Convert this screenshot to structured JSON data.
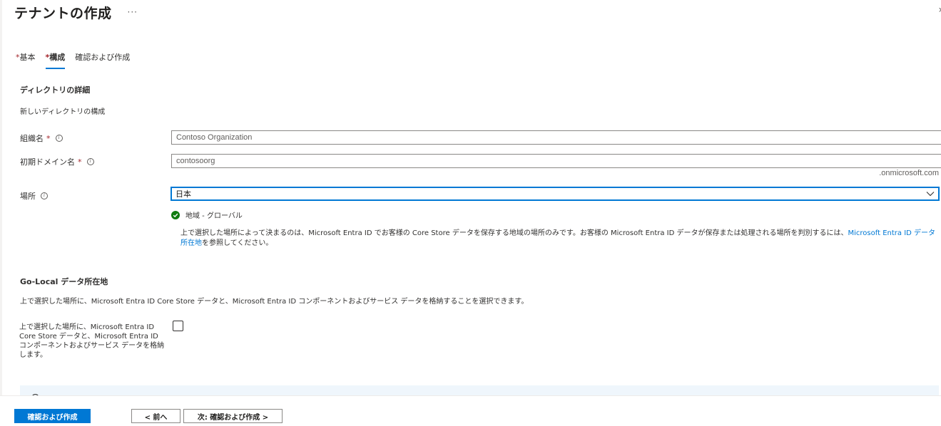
{
  "header": {
    "title": "テナントの作成",
    "more": "···",
    "expand_icon": "chevron-right-icon"
  },
  "tabs": [
    {
      "required": "*",
      "label": "基本",
      "active": false
    },
    {
      "required": "*",
      "label": "構成",
      "active": true
    },
    {
      "required": "",
      "label": "確認および作成",
      "active": false
    }
  ],
  "directory": {
    "title": "ディレクトリの詳細",
    "subtitle": "新しいディレクトリの構成"
  },
  "form": {
    "org_name": {
      "label": "組織名",
      "required": "*",
      "info_icon": "info-icon",
      "value": "Contoso Organization"
    },
    "domain": {
      "label": "初期ドメイン名",
      "required": "*",
      "info_icon": "info-icon",
      "value": "contosoorg",
      "suffix": ".onmicrosoft.com"
    },
    "location": {
      "label": "場所",
      "info_icon": "info-icon",
      "selected": "日本",
      "region_status": "地域 - グローバル",
      "note_prefix": "上で選択した場所によって決まるのは、Microsoft Entra ID でお客様の Core Store データを保存する地域の場所のみです。お客様の Microsoft Entra ID データが保存または処理される場所を判別するには、",
      "note_link": "Microsoft Entra ID データ所在地",
      "note_suffix": "を参照してください。"
    }
  },
  "go_local": {
    "title": "Go-Local データ所在地",
    "description": "上で選択した場所に、Microsoft Entra ID Core Store データと、Microsoft Entra ID コンポーネントおよびサービス データを格納することを選択できます。",
    "checkbox_label": "上で選択した場所に、Microsoft Entra ID Core Store データと、Microsoft Entra ID コンポーネントおよびサービス データを格納します。",
    "checked": false
  },
  "footer": {
    "review_create": "確認および作成",
    "previous": "< 前へ",
    "next": "次: 確認および作成 >"
  },
  "colors": {
    "accent": "#0078d4",
    "required": "#a4262c",
    "success": "#107c10",
    "banner": "#eff6fc"
  }
}
